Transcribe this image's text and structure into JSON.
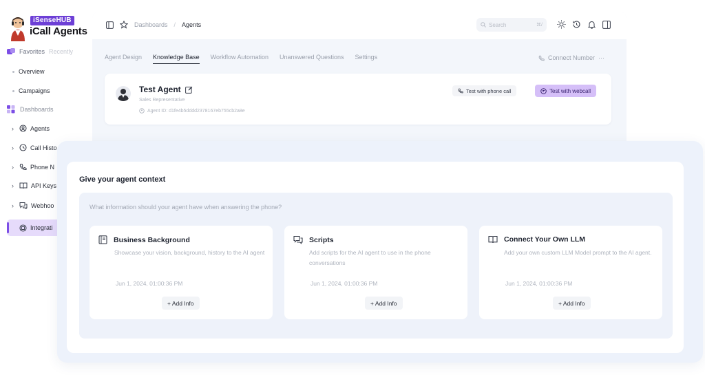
{
  "brand": {
    "badge": "iSenseHUB",
    "name": "iCall Agents"
  },
  "sidebar": {
    "tabs": {
      "favorites": "Favorites",
      "recently": "Recently"
    },
    "quick_links": [
      {
        "label": "Overview"
      },
      {
        "label": "Campaigns"
      }
    ],
    "section_label": "Dashboards",
    "items": [
      {
        "label": "Agents",
        "icon": "agents-icon"
      },
      {
        "label": "Call Histo",
        "icon": "history-icon"
      },
      {
        "label": "Phone N",
        "icon": "phone-icon"
      },
      {
        "label": "API Keys",
        "icon": "book-icon"
      },
      {
        "label": "Webhoo",
        "icon": "chat-icon"
      },
      {
        "label": "Integrati",
        "icon": "integration-icon"
      }
    ],
    "active_index": 5
  },
  "header": {
    "breadcrumb": [
      "Dashboards",
      "Agents"
    ],
    "search_placeholder": "Search",
    "search_shortcut": "⌘/"
  },
  "tabs": [
    {
      "label": "Agent Design"
    },
    {
      "label": "Knowledge Base"
    },
    {
      "label": "Workflow Automation"
    },
    {
      "label": "Unanswered Questions"
    },
    {
      "label": "Settings"
    }
  ],
  "active_tab": "Knowledge Base",
  "connect_number": {
    "label": "Connect Number",
    "more": "···"
  },
  "agent": {
    "name": "Test Agent",
    "role": "Sales Representative",
    "id_label": "Agent ID: d1fe4b5dddd2378167eb755cb2a8e",
    "test_phone_label": "Test with phone call",
    "test_web_label": "Test with webcall"
  },
  "context": {
    "title": "Give your agent context",
    "question": "What information should your agent have when answering the phone?",
    "cards": [
      {
        "title": "Business Background",
        "icon": "document-icon",
        "description": "Showcase your vision, background, history to the AI agent",
        "date": "Jun 1, 2024, 01:00:36 PM",
        "button": "+ Add Info"
      },
      {
        "title": "Scripts",
        "icon": "chat-bubbles-icon",
        "description": "Add scripts for the AI agent to use in the phone conversations",
        "date": "Jun 1, 2024, 01:00:36 PM",
        "button": "+ Add Info"
      },
      {
        "title": "Connect Your Own LLM",
        "icon": "open-book-icon",
        "description": "Add your own custom LLM Model prompt to the AI agent.",
        "date": "Jun 1, 2024, 01:00:36 PM",
        "button": "+ Add Info"
      }
    ]
  },
  "colors": {
    "accent": "#7c4ee6",
    "accent_light": "#e6dbfb",
    "webcall_button": "#d5bff8",
    "panel_bg": "#eef2fa"
  }
}
